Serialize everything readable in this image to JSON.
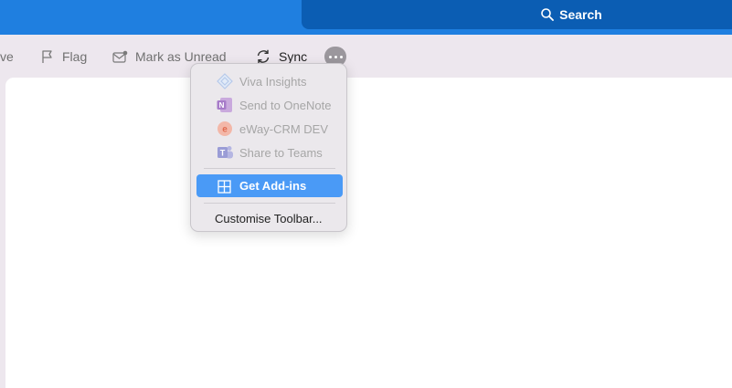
{
  "search": {
    "label": "Search"
  },
  "toolbar": {
    "archive_partial": "ve",
    "flag": "Flag",
    "mark_unread": "Mark as Unread",
    "sync": "Sync"
  },
  "menu": {
    "items": [
      {
        "label": "Viva Insights",
        "icon": "viva-insights-icon",
        "enabled": false
      },
      {
        "label": "Send to OneNote",
        "icon": "onenote-icon",
        "enabled": false
      },
      {
        "label": "eWay-CRM DEV",
        "icon": "eway-crm-icon",
        "enabled": false
      },
      {
        "label": "Share to Teams",
        "icon": "teams-icon",
        "enabled": false
      }
    ],
    "get_addins": "Get Add-ins",
    "customise": "Customise Toolbar..."
  },
  "colors": {
    "titlebar": "#1f7fe0",
    "search": "#0b5db3",
    "highlight": "#4a9af6"
  }
}
